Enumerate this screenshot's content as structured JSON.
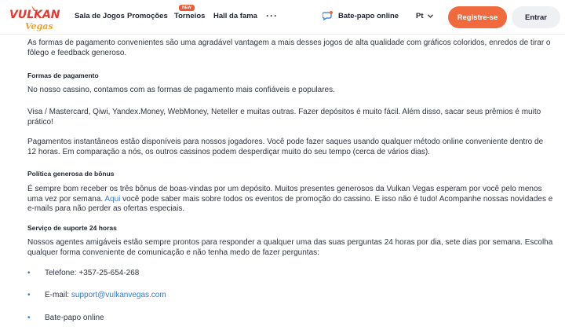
{
  "header": {
    "logo_text": "VULKAN Vegas",
    "nav": {
      "games": "Sala de Jogos",
      "promos": "Promoções",
      "tournaments": "Torneios",
      "tournaments_badge": "NEW",
      "hall": "Hall da fama"
    },
    "chat_label": "Bate-papo online",
    "language": "Pt",
    "register_label": "Registre-se",
    "login_label": "Entrar",
    "colors": {
      "accent": "#f06a3d",
      "link": "#2f7bd6"
    }
  },
  "content": {
    "intro": "As formas de pagamento convenientes são uma agradável vantagem a mais desses jogos de alta qualidade com gráficos coloridos, enredos de tirar o fôlego e feedback generoso.",
    "payment_heading": "Formas de pagamento",
    "payment_p1": "No nosso cassino, contamos com as formas de pagamento mais confiáveis e populares.",
    "payment_p2": "Visa / Mastercard, Qiwi, Yandex.Money, WebMoney, Neteller e muitas outras. Fazer depósitos é muito fácil. Além disso, sacar seus prêmios é muito prático!",
    "payment_p3": "Pagamentos instantâneos estão disponíveis para nossos jogadores. Você pode fazer saques usando qualquer método online conveniente dentro de 12 horas. Em comparação a nós, os outros cassinos podem desperdiçar muito do seu tempo (cerca de vários dias).",
    "bonus_heading": "Política generosa de bônus",
    "bonus_p_before": "É sempre bom receber os três bônus de boas-vindas por um depósito. Muitos presentes generosos da Vulkan Vegas esperam por você pelo menos uma vez por semana. ",
    "bonus_link": "Aqui",
    "bonus_p_after": " você pode saber mais sobre todos os eventos de promoção do cassino. E isso não é tudo! Acompanhe nossas novidades e e-mails para não perder as ofertas especiais.",
    "support_heading": "Serviço de suporte 24 horas",
    "support_p": "Nossos agentes amigáveis estão sempre prontos para responder a qualquer uma das suas perguntas 24 horas por dia, sete dias por semana. Escolha qualquer forma conveniente de comunicação e não tenha medo de fazer perguntas:",
    "contacts": {
      "phone": "Telefone: +357-25-654-268",
      "email_label": "E-mail: ",
      "email": "support@vulkanvegas.com",
      "chat": "Bate-papo online"
    }
  }
}
